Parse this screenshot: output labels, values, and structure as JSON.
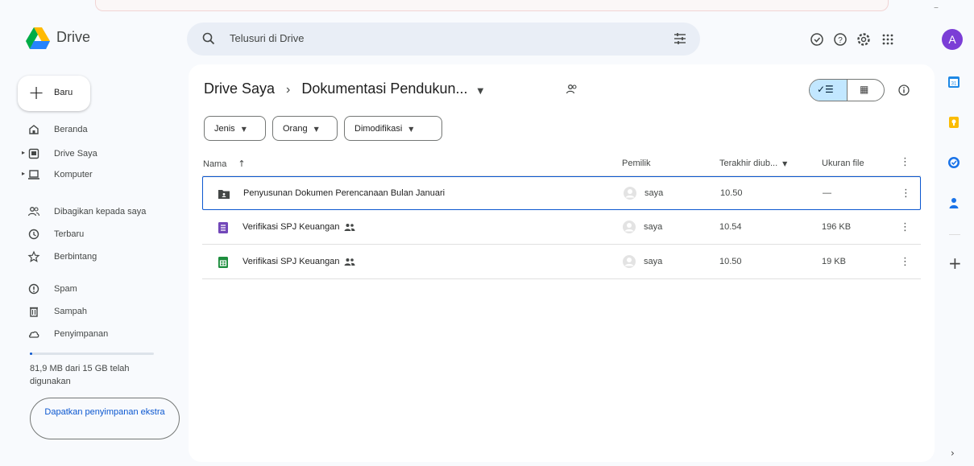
{
  "app": {
    "name": "Drive"
  },
  "search": {
    "placeholder": "Telusuri di Drive"
  },
  "user": {
    "avatar_letter": "A",
    "avatar_color": "#7b3ed6"
  },
  "sidebar": {
    "new_label": "Baru",
    "items": [
      {
        "label": "Beranda",
        "icon": "home-icon"
      },
      {
        "label": "Drive Saya",
        "icon": "my-drive-icon"
      },
      {
        "label": "Komputer",
        "icon": "computer-icon"
      },
      {
        "label": "Dibagikan kepada saya",
        "icon": "shared-icon"
      },
      {
        "label": "Terbaru",
        "icon": "clock-icon"
      },
      {
        "label": "Berbintang",
        "icon": "star-icon"
      },
      {
        "label": "Spam",
        "icon": "spam-icon"
      },
      {
        "label": "Sampah",
        "icon": "trash-icon"
      },
      {
        "label": "Penyimpanan",
        "icon": "cloud-icon"
      }
    ],
    "storage_text": "81,9 MB dari 15 GB telah digunakan",
    "storage_fraction": 0.005,
    "get_storage_label": "Dapatkan penyimpanan ekstra"
  },
  "breadcrumb": {
    "root": "Drive Saya",
    "separator": "›",
    "current": "Dokumentasi Pendukun..."
  },
  "filters": [
    {
      "label": "Jenis"
    },
    {
      "label": "Orang"
    },
    {
      "label": "Dimodifikasi"
    }
  ],
  "table": {
    "columns": {
      "name": "Nama",
      "owner": "Pemilik",
      "modified": "Terakhir diub...",
      "size": "Ukuran file"
    },
    "rows": [
      {
        "name": "Penyusunan Dokumen Perencanaan Bulan Januari",
        "type": "folder",
        "shared": false,
        "owner": "saya",
        "modified": "10.50",
        "size": "—"
      },
      {
        "name": "Verifikasi SPJ Keuangan",
        "type": "form",
        "shared": true,
        "owner": "saya",
        "modified": "10.54",
        "size": "196 KB"
      },
      {
        "name": "Verifikasi SPJ Keuangan",
        "type": "sheet",
        "shared": true,
        "owner": "saya",
        "modified": "10.50",
        "size": "19 KB"
      }
    ]
  },
  "colors": {
    "accent": "#0b57d0",
    "selected_toggle": "#c2e7ff",
    "forms": "#7248b9",
    "sheets": "#1e8e3e"
  }
}
